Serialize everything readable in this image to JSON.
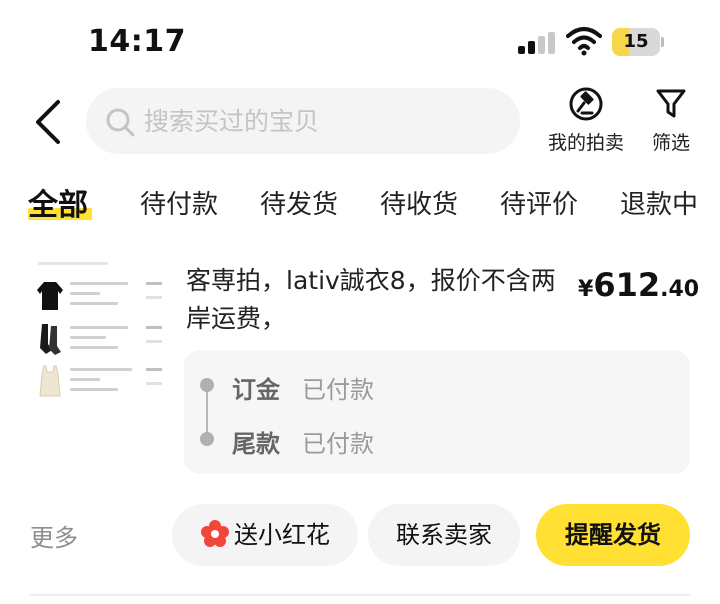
{
  "status_bar": {
    "time": "14:17",
    "battery_level": "15",
    "battery_fraction": 0.15,
    "icons": [
      "cellular-signal-icon",
      "wifi-icon",
      "battery-icon"
    ]
  },
  "header": {
    "search_placeholder": "搜索买过的宝贝",
    "auction_label": "我的拍卖",
    "filter_label": "筛选",
    "icons": [
      "back-chevron-icon",
      "search-icon",
      "gavel-icon",
      "filter-funnel-icon"
    ]
  },
  "tabs": [
    {
      "label": "全部",
      "active": true
    },
    {
      "label": "待付款",
      "active": false
    },
    {
      "label": "待发货",
      "active": false
    },
    {
      "label": "待收货",
      "active": false
    },
    {
      "label": "待评价",
      "active": false
    },
    {
      "label": "退款中",
      "active": false
    }
  ],
  "order": {
    "title": "客専拍，lativ誠衣8，报价不含两岸运费，",
    "price_currency": "¥",
    "price_integer": "612",
    "price_decimal": ".40",
    "payments": [
      {
        "label": "订金",
        "status": "已付款"
      },
      {
        "label": "尾款",
        "status": "已付款"
      }
    ]
  },
  "actions": {
    "more": "更多",
    "send_flower": "送小红花",
    "contact_seller": "联系卖家",
    "remind_ship": "提醒发货"
  },
  "colors": {
    "accent_yellow": "#ffe033",
    "flower_red": "#f0473a",
    "muted_text": "#9a9a9a"
  }
}
